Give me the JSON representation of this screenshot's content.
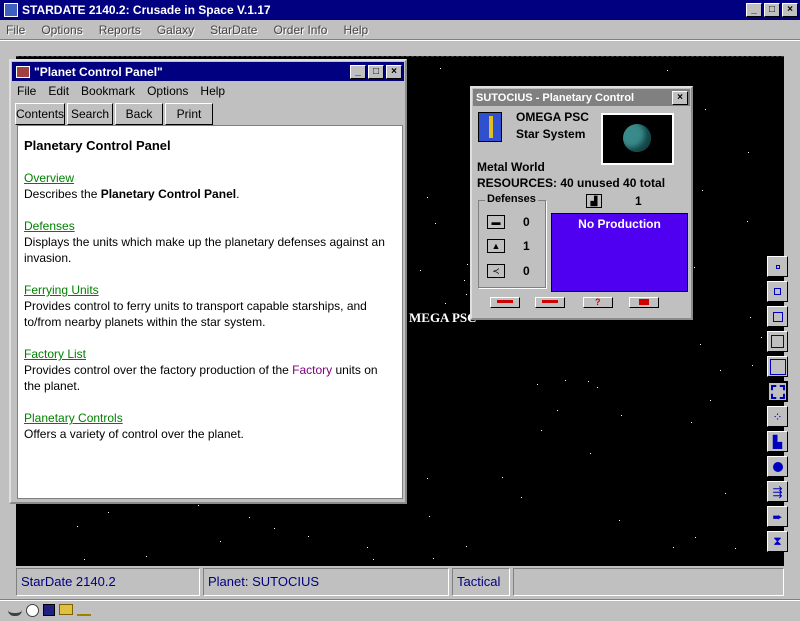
{
  "app": {
    "title": "STARDATE 2140.2: Crusade in Space V.1.17",
    "menu": [
      "File",
      "Options",
      "Reports",
      "Galaxy",
      "StarDate",
      "Order Info",
      "Help"
    ]
  },
  "help_window": {
    "title": "\"Planet Control Panel\"",
    "menu": [
      "File",
      "Edit",
      "Bookmark",
      "Options",
      "Help"
    ],
    "buttons": [
      "Contents",
      "Search",
      "Back",
      "Print"
    ],
    "heading": "Planetary Control Panel",
    "sections": [
      {
        "link": "Overview",
        "text_before": "Describes the ",
        "bold": "Planetary Control Panel",
        "text_after": "."
      },
      {
        "link": "Defenses",
        "text": "Displays the units which make up the planetary defenses against an invasion."
      },
      {
        "link": "Ferrying Units",
        "text": "Provides control to ferry units to transport capable starships, and to/from nearby planets within the star system."
      },
      {
        "link": "Factory List",
        "text_before": "Provides control over the factory production of the ",
        "colored": "Factory",
        "text_after": " units on the planet."
      },
      {
        "link": "Planetary Controls",
        "text": "Offers a variety of control over the planet."
      }
    ]
  },
  "planet_panel": {
    "title": "SUTOCIUS - Planetary Control",
    "owner": "OMEGA PSC",
    "system": "Star System",
    "world_type": "Metal World",
    "resources": "RESOURCES: 40 unused 40 total",
    "factory_count": "1",
    "defenses_label": "Defenses",
    "defenses": [
      "0",
      "1",
      "0"
    ],
    "production": "No Production",
    "colors": {
      "production_bg": "#5000f0",
      "planet": "#3a8a8a"
    }
  },
  "map": {
    "label": "MEGA PSC"
  },
  "status": {
    "stardate": "StarDate 2140.2",
    "planet": "Planet: SUTOCIUS",
    "mode": "Tactical"
  }
}
